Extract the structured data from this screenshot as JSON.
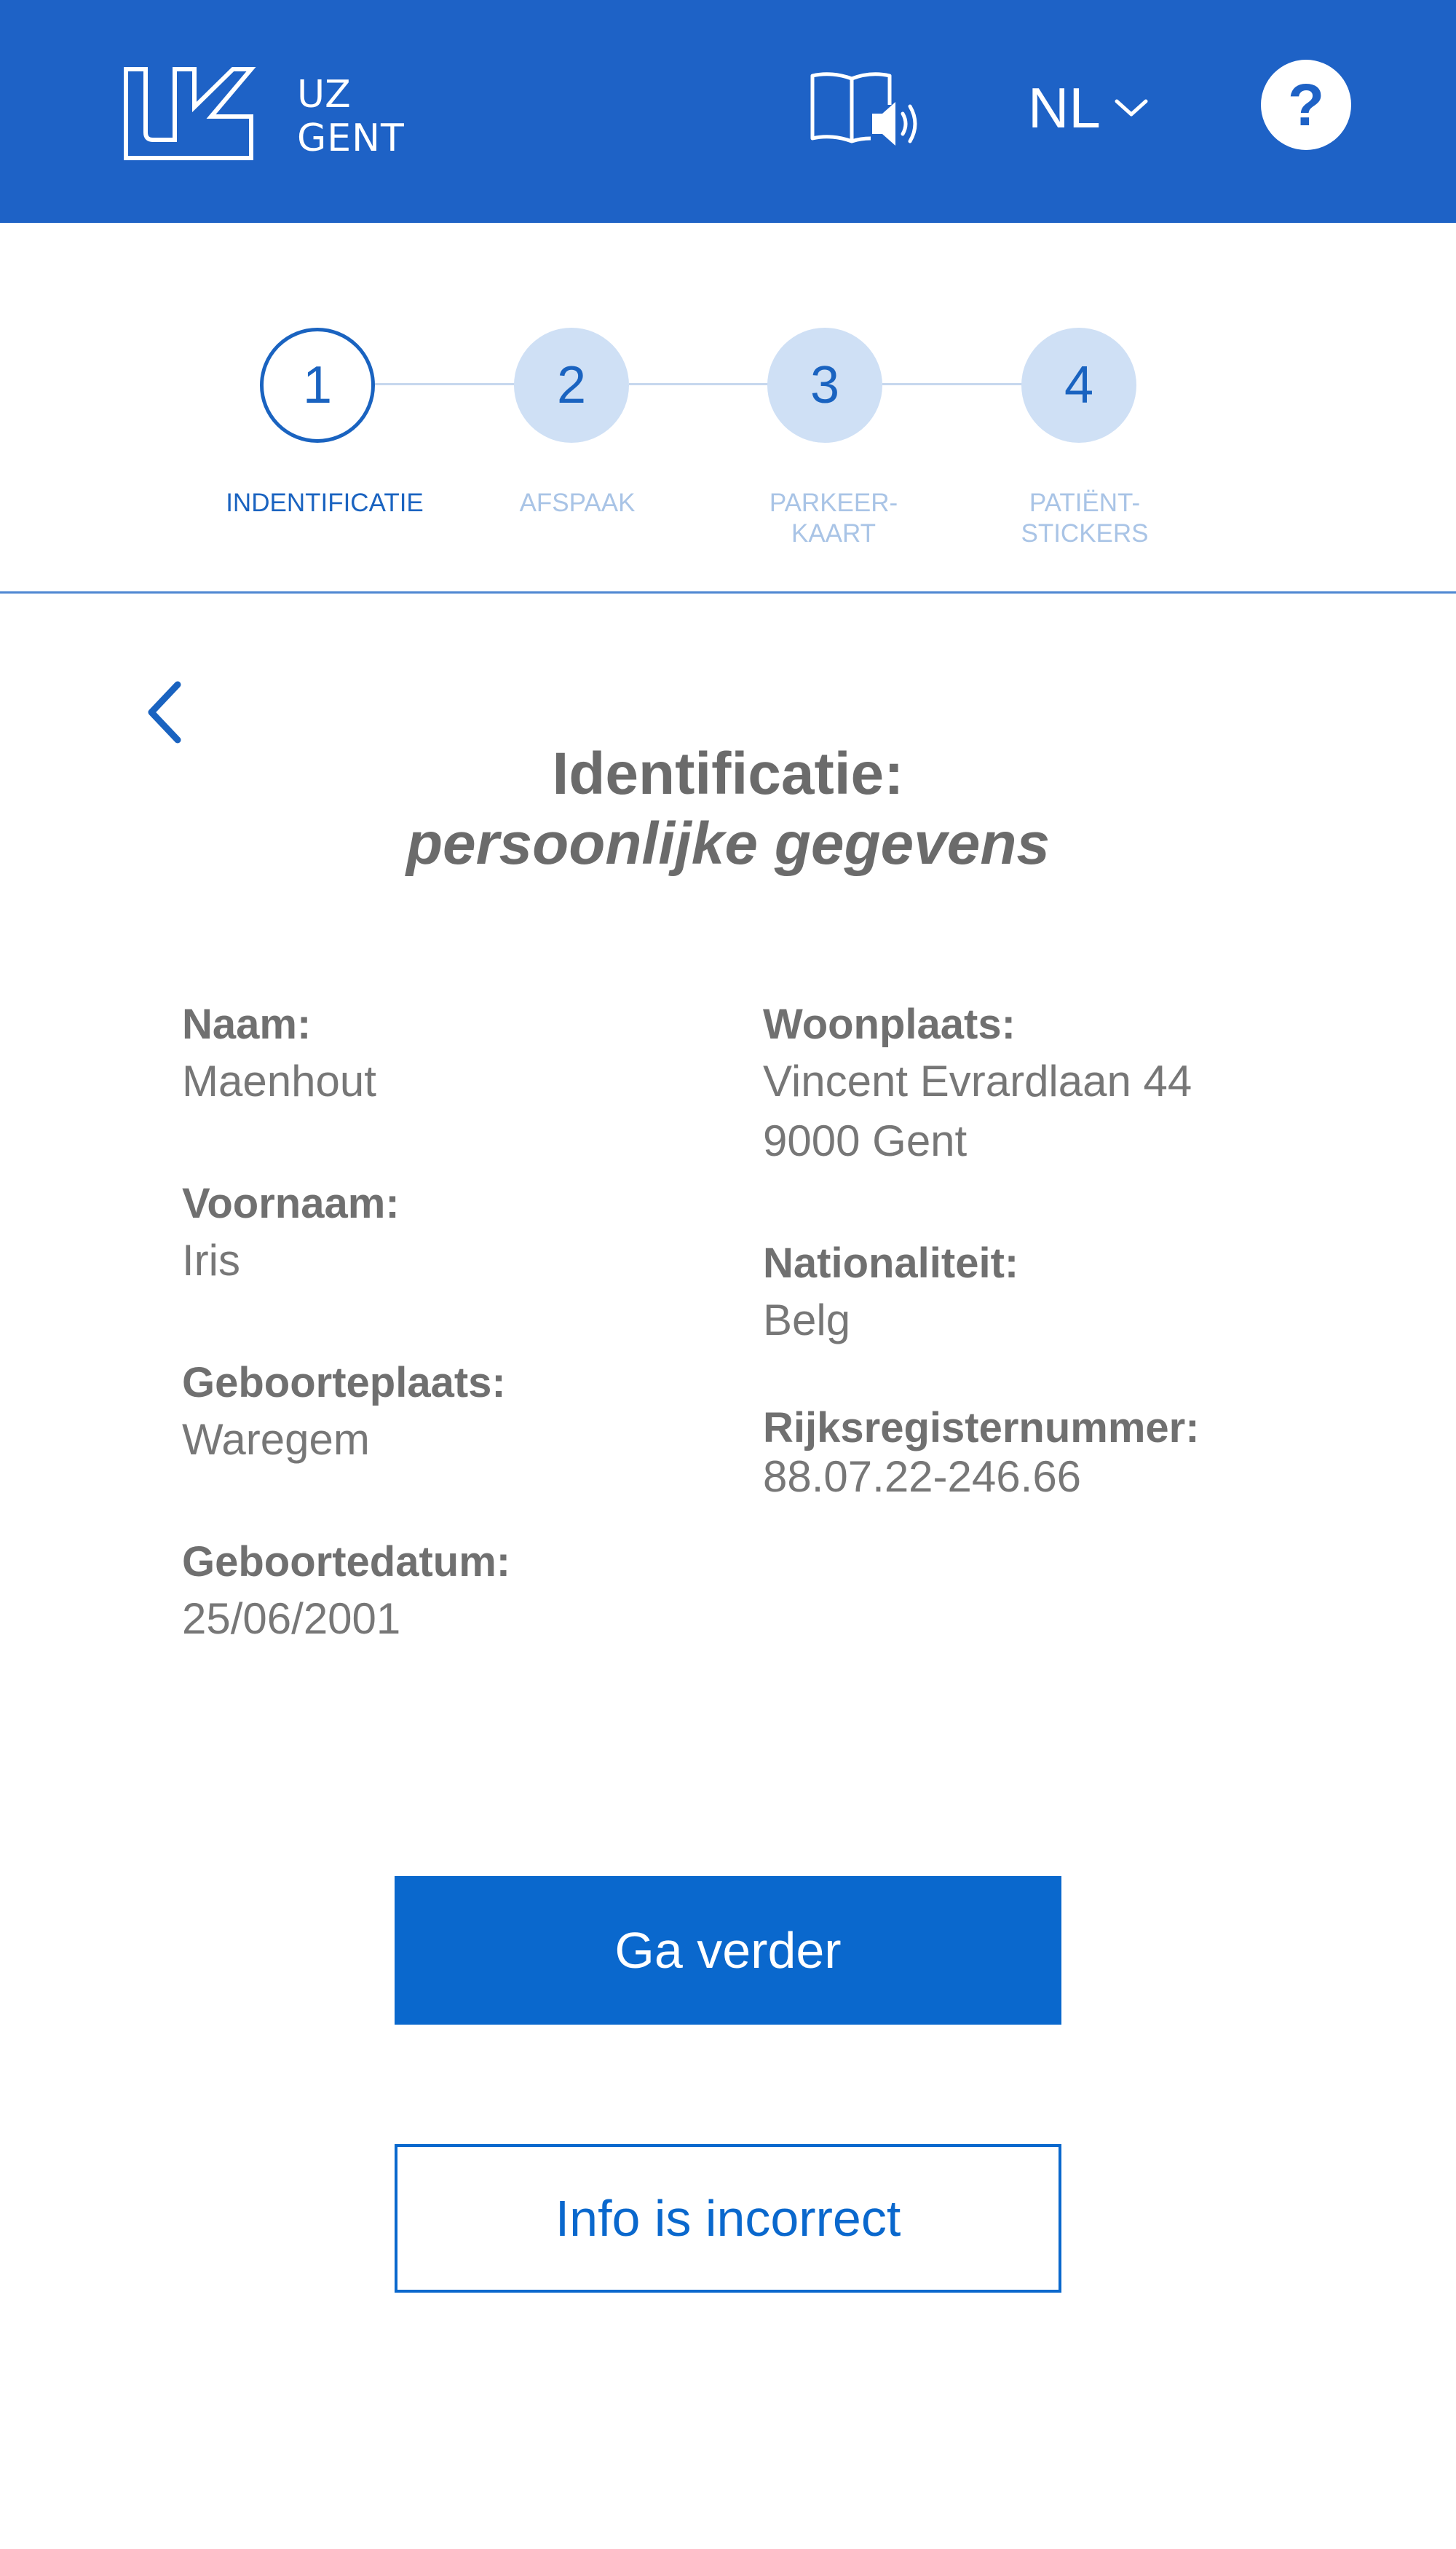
{
  "header": {
    "logo_text_line1": "UZ",
    "logo_text_line2": "GENT",
    "language": "NL",
    "brand_color": "#1e62c6"
  },
  "stepper": {
    "steps": [
      {
        "number": "1",
        "label": "INDENTIFICATIE",
        "state": "active"
      },
      {
        "number": "2",
        "label": "AFSPAAK",
        "state": "todo"
      },
      {
        "number": "3",
        "label": "PARKEER-\nKAART",
        "state": "todo"
      },
      {
        "number": "4",
        "label": "PATIËNT-\nSTICKERS",
        "state": "todo"
      }
    ]
  },
  "main": {
    "title": "Identificatie:",
    "subtitle": "persoonlijke gegevens",
    "left_fields": [
      {
        "label": "Naam:",
        "value": "Maenhout"
      },
      {
        "label": "Voornaam:",
        "value": "Iris"
      },
      {
        "label": "Geboorteplaats:",
        "value": "Waregem"
      },
      {
        "label": "Geboortedatum:",
        "value": "25/06/2001"
      }
    ],
    "right_fields": [
      {
        "label": "Woonplaats:",
        "value_line1": "Vincent Evrardlaan 44",
        "value_line2": "9000 Gent"
      },
      {
        "label": "Nationaliteit:",
        "value": "Belg"
      },
      {
        "label": "Rijksregisternummer:",
        "value": "88.07.22-246.66"
      }
    ]
  },
  "actions": {
    "continue_label": "Ga verder",
    "incorrect_label": "Info is incorrect",
    "accent_color": "#0a68cd"
  }
}
